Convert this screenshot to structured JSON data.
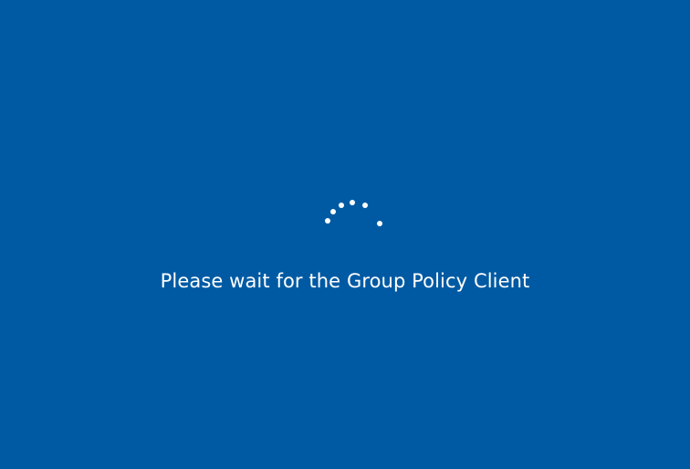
{
  "screen": {
    "background_color": "#005aa3",
    "message": "Please wait for the Group Policy Client",
    "text_color": "#ffffff"
  },
  "spinner": {
    "icon": "loading-spinner-icon",
    "dot_count": 6
  }
}
